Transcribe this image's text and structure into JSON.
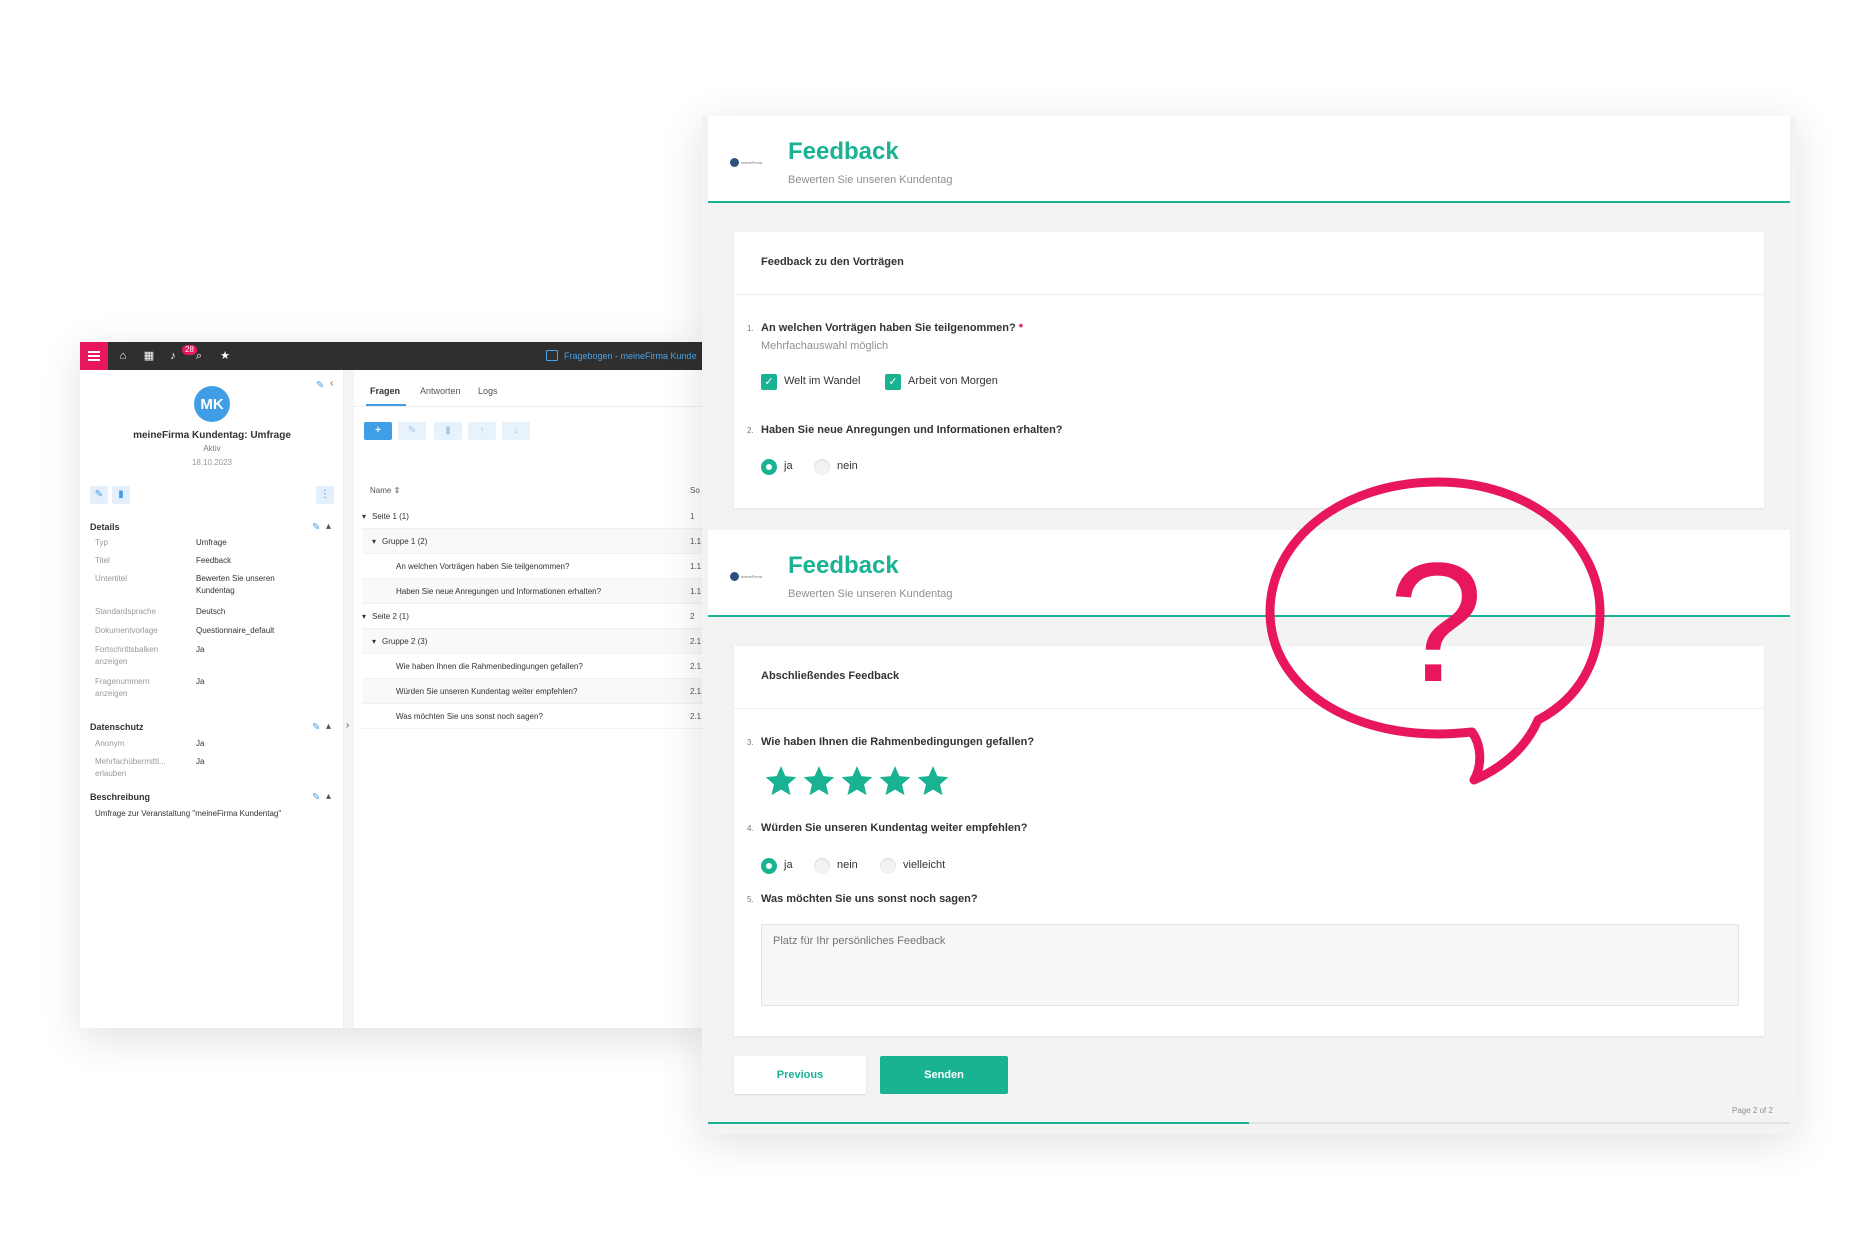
{
  "crm": {
    "topbar": {
      "notification_count": "28",
      "window_title": "Fragebogen - meineFirma Kunde"
    },
    "record": {
      "initials": "MK",
      "name": "meineFirma Kundentag: Umfrage",
      "status": "Aktiv",
      "date": "18.10.2023"
    },
    "details": {
      "title": "Details",
      "rows": [
        {
          "key": "Typ",
          "value": "Umfrage"
        },
        {
          "key": "Titel",
          "value": "Feedback"
        },
        {
          "key": "Untertitel",
          "value": "Bewerten Sie unseren Kundentag"
        },
        {
          "key": "Standardsprache",
          "value": "Deutsch"
        },
        {
          "key": "Dokumentvorlage",
          "value": "Questionnaire_default"
        },
        {
          "key": "Fortschrittsbalken anzeigen",
          "value": "Ja"
        },
        {
          "key": "Fragenummern anzeigen",
          "value": "Ja"
        }
      ]
    },
    "privacy": {
      "title": "Datenschutz",
      "rows": [
        {
          "key": "Anonym",
          "value": "Ja"
        },
        {
          "key": "Mehrfachübermittl... erlauben",
          "value": "Ja"
        }
      ]
    },
    "description": {
      "title": "Beschreibung",
      "text": "Umfrage zur Veranstaltung \"meineFirma Kundentag\""
    },
    "tabs": [
      {
        "label": "Fragen",
        "active": true
      },
      {
        "label": "Antworten",
        "active": false
      },
      {
        "label": "Logs",
        "active": false
      }
    ],
    "toolbar": {
      "add": "+",
      "edit_icon": "pencil-icon",
      "delete_icon": "trash-icon",
      "up_icon": "arrow-up-icon",
      "down_icon": "arrow-down-icon"
    },
    "table": {
      "col_name": "Name",
      "col_sort": "So",
      "rows": [
        {
          "label": "Seite 1 (1)",
          "num": "1"
        },
        {
          "label": "Gruppe 1 (2)",
          "num": "1.1"
        },
        {
          "label": "An welchen Vorträgen haben Sie teilgenommen?",
          "num": "1.1."
        },
        {
          "label": "Haben Sie neue Anregungen und Informationen erhalten?",
          "num": "1.1."
        },
        {
          "label": "Seite 2 (1)",
          "num": "2"
        },
        {
          "label": "Gruppe 2 (3)",
          "num": "2.1"
        },
        {
          "label": "Wie haben Ihnen die Rahmenbedingungen gefallen?",
          "num": "2.1."
        },
        {
          "label": "Würden Sie unseren Kundentag weiter empfehlen?",
          "num": "2.1."
        },
        {
          "label": "Was möchten Sie uns sonst noch sagen?",
          "num": "2.1."
        }
      ]
    }
  },
  "survey": {
    "logo_text": "meineFirma",
    "title": "Feedback",
    "subtitle": "Bewerten Sie unseren Kundentag",
    "page1": {
      "panel_title": "Feedback zu den Vorträgen",
      "q1": {
        "num": "1.",
        "text": "An welchen Vorträgen haben Sie teilgenommen?",
        "required_mark": "*",
        "description": "Mehrfachauswahl möglich",
        "options": [
          "Welt im Wandel",
          "Arbeit von Morgen"
        ]
      },
      "q2": {
        "num": "2.",
        "text": "Haben Sie neue Anregungen und Informationen erhalten?",
        "options": [
          "ja",
          "nein"
        ],
        "selected": "ja"
      }
    },
    "page2": {
      "panel_title": "Abschließendes Feedback",
      "q3": {
        "num": "3.",
        "text": "Wie haben Ihnen die Rahmenbedingungen gefallen?",
        "rating": 5,
        "max": 5
      },
      "q4": {
        "num": "4.",
        "text": "Würden Sie unseren Kundentag weiter empfehlen?",
        "options": [
          "ja",
          "nein",
          "vielleicht"
        ],
        "selected": "ja"
      },
      "q5": {
        "num": "5.",
        "text": "Was möchten Sie uns sonst noch sagen?",
        "placeholder": "Platz für Ihr persönliches Feedback"
      },
      "prev_label": "Previous",
      "send_label": "Senden",
      "page_indicator": "Page 2 of 2",
      "progress": 0.5
    },
    "accent_color": "#19b394",
    "bubble_color": "#e8175d",
    "bubble_glyph": "?"
  }
}
